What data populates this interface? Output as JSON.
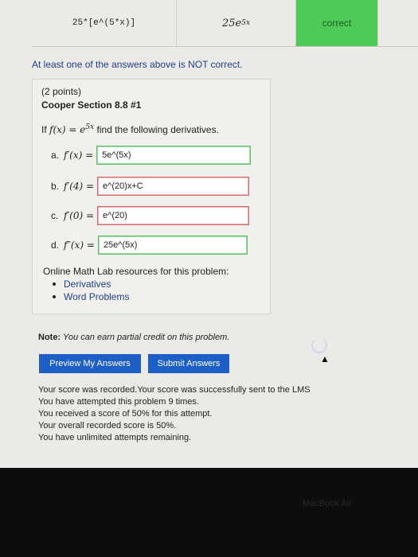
{
  "result_row": {
    "entered": "25*[e^(5*x)]",
    "preview": "25e",
    "preview_sup": "5x",
    "status": "correct"
  },
  "warning": "At least one of the answers above is NOT correct.",
  "problem": {
    "points": "(2 points)",
    "section": "Cooper Section 8.8 #1",
    "intro_prefix": "If ",
    "intro_func": "f(x) = e",
    "intro_sup": "5x",
    "intro_suffix": " find the following derivatives.",
    "questions": [
      {
        "letter": "a.",
        "lhs": "f′(x) =",
        "value": "5e^(5x)",
        "state": "ok"
      },
      {
        "letter": "b.",
        "lhs": "f′(4) =",
        "value": "e^(20)x+C",
        "state": "bad"
      },
      {
        "letter": "c.",
        "lhs": "f′(0) =",
        "value": "e^(20)",
        "state": "bad"
      },
      {
        "letter": "d.",
        "lhs": "f″(x) =",
        "value": "25e^(5x)",
        "state": "ok"
      }
    ]
  },
  "resources": {
    "heading": "Online Math Lab resources for this problem:",
    "links": [
      "Derivatives",
      "Word Problems"
    ]
  },
  "note": {
    "label": "Note:",
    "text": "You can earn partial credit on this problem."
  },
  "buttons": {
    "preview": "Preview My Answers",
    "submit": "Submit Answers"
  },
  "score_lines": [
    "Your score was recorded.Your score was successfully sent to the LMS",
    "You have attempted this problem 9 times.",
    "You received a score of 50% for this attempt.",
    "Your overall recorded score is 50%.",
    "You have unlimited attempts remaining."
  ],
  "bezel": "MacBook Air",
  "colors": {
    "correct_bg": "#4ecb57",
    "button_bg": "#1e5ec7",
    "link": "#1d3f8c"
  }
}
